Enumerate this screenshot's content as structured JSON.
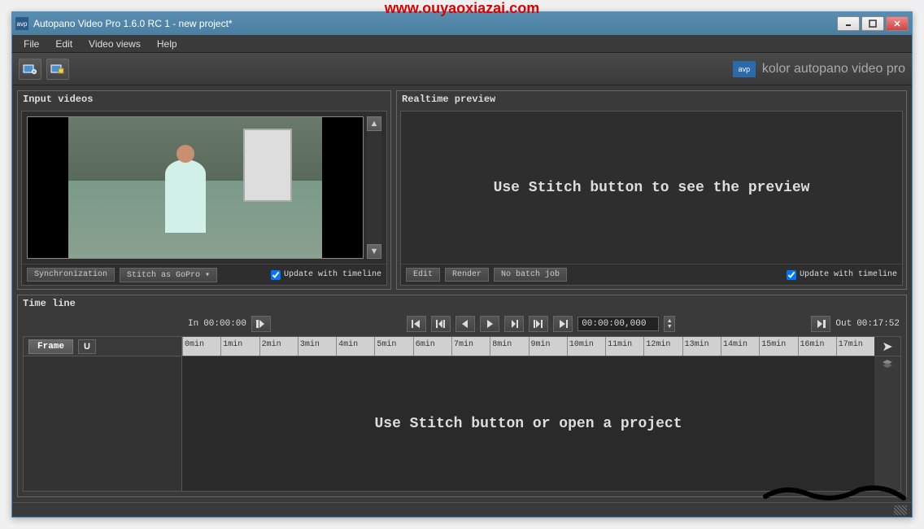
{
  "watermark": "www.ouyaoxiazai.com",
  "window": {
    "title": "Autopano Video Pro 1.6.0 RC 1 - new project*",
    "icon_text": "avp"
  },
  "menu": [
    "File",
    "Edit",
    "Video views",
    "Help"
  ],
  "brand": {
    "icon_text": "avp",
    "text": "kolor autopano video pro"
  },
  "input_panel": {
    "title": "Input videos",
    "sync_btn": "Synchronization",
    "stitch_btn": "Stitch  as GoPro",
    "update_label": "Update with timeline"
  },
  "preview_panel": {
    "title": "Realtime preview",
    "message": "Use Stitch button to see the preview",
    "edit_btn": "Edit",
    "render_btn": "Render",
    "batch_btn": "No batch job",
    "update_label": "Update with timeline"
  },
  "timeline": {
    "title": "Time line",
    "in_label": "In",
    "in_time": "00:00:00",
    "out_label": "Out",
    "out_time": "00:17:52",
    "current_time": "00:00:00,000",
    "frame_btn": "Frame",
    "ruler": [
      "0min",
      "1min",
      "2min",
      "3min",
      "4min",
      "5min",
      "6min",
      "7min",
      "8min",
      "9min",
      "10min",
      "11min",
      "12min",
      "13min",
      "14min",
      "15min",
      "16min",
      "17min"
    ],
    "message": "Use Stitch button or open a project"
  }
}
